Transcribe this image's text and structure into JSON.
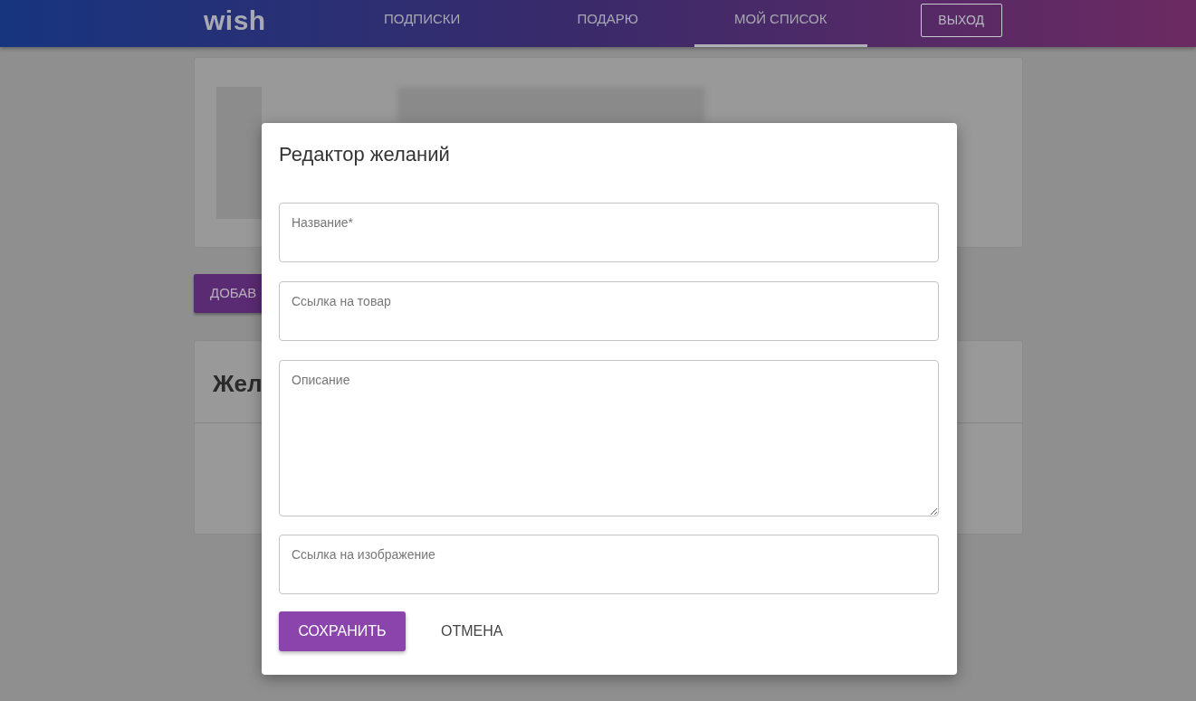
{
  "header": {
    "logo": "wish",
    "nav": [
      {
        "label": "ПОДПИСКИ",
        "selected": false
      },
      {
        "label": "ПОДАРЮ",
        "selected": false
      },
      {
        "label": "МОЙ СПИСОК",
        "selected": true
      }
    ],
    "logout": "ВЫХОД"
  },
  "add_button": "ДОБАВ",
  "wishes_card": {
    "title": "Жел"
  },
  "dialog": {
    "title": "Редактор желаний",
    "fields": [
      {
        "kind": "input",
        "placeholder": "Название*"
      },
      {
        "kind": "input",
        "placeholder": "Ссылка на товар"
      },
      {
        "kind": "textarea",
        "placeholder": "Описание"
      },
      {
        "kind": "input",
        "placeholder": "Ссылка на изображение"
      }
    ],
    "save": "СОХРАНИТЬ",
    "cancel": "ОТМЕНА"
  }
}
